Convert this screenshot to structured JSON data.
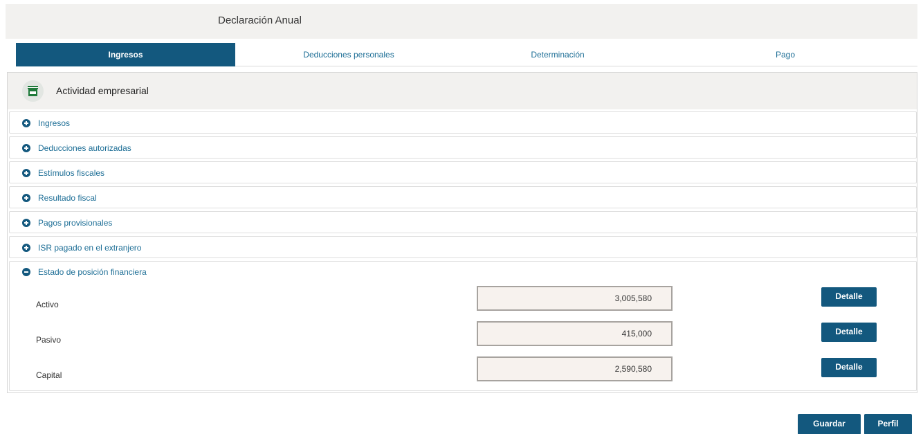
{
  "header": {
    "title": "Declaración Anual"
  },
  "tabs": [
    {
      "label": "Ingresos"
    },
    {
      "label": "Deducciones personales"
    },
    {
      "label": "Determinación"
    },
    {
      "label": "Pago"
    }
  ],
  "panel": {
    "title": "Actividad empresarial",
    "icon": "store-icon",
    "sections": [
      {
        "label": "Ingresos"
      },
      {
        "label": "Deducciones autorizadas"
      },
      {
        "label": "Estímulos fiscales"
      },
      {
        "label": "Resultado fiscal"
      },
      {
        "label": "Pagos provisionales"
      },
      {
        "label": "ISR pagado en el extranjero"
      }
    ],
    "expanded_section": {
      "label": "Estado de posición financiera",
      "rows": [
        {
          "label": "Activo",
          "value": "3,005,580",
          "button": "Detalle"
        },
        {
          "label": "Pasivo",
          "value": "415,000",
          "button": "Detalle"
        },
        {
          "label": "Capital",
          "value": "2,590,580",
          "button": "Detalle"
        }
      ]
    }
  },
  "footer": {
    "save_label": "Guardar",
    "profile_label": "Perfil"
  },
  "colors": {
    "accent": "#13587e",
    "link": "#1d6e96",
    "header_bg": "#f2f1ef"
  }
}
